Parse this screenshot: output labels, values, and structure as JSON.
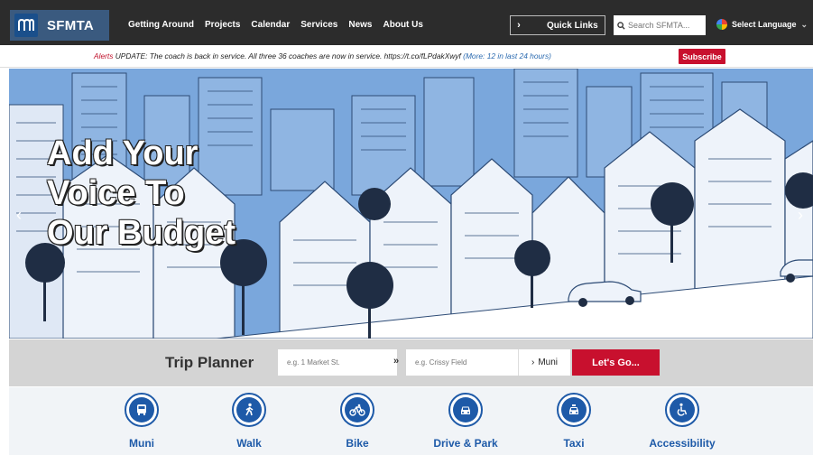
{
  "brand": {
    "name": "SFMTA",
    "logo_icon": "muni-worm-logo-icon"
  },
  "nav": {
    "items": [
      "Getting Around",
      "Projects",
      "Calendar",
      "Services",
      "News",
      "About Us"
    ]
  },
  "quick_links": {
    "label": "Quick Links",
    "icon": "chevron-right-icon"
  },
  "search": {
    "placeholder": "Search SFMTA...",
    "icon": "search-icon"
  },
  "language": {
    "label": "Select Language",
    "icon": "google-translate-icon"
  },
  "alerts": {
    "label": "Alerts",
    "message": " UPDATE: The coach is back in service. All three 36 coaches are now in service. https://t.co/fLPdakXwyf ",
    "more": "(More: 12 in last 24 hours)",
    "subscribe_label": "Subscribe"
  },
  "hero": {
    "line1": "Add Your",
    "line2": "Voice To",
    "line3": "Our Budget",
    "prev_icon": "chevron-left-icon",
    "next_icon": "chevron-right-icon",
    "slide_count": 4,
    "active_slide": 2
  },
  "trip_planner": {
    "title": "Trip Planner",
    "from_placeholder": "e.g. 1 Market St.",
    "swap_label": "»",
    "to_placeholder": "e.g. Crissy Field",
    "mode_label": "Muni",
    "go_label": "Let's Go..."
  },
  "modes": [
    {
      "label": "Muni",
      "icon": "bus-icon"
    },
    {
      "label": "Walk",
      "icon": "walking-person-icon"
    },
    {
      "label": "Bike",
      "icon": "bicycle-icon"
    },
    {
      "label": "Drive & Park",
      "icon": "car-icon"
    },
    {
      "label": "Taxi",
      "icon": "taxi-icon"
    },
    {
      "label": "Accessibility",
      "icon": "wheelchair-icon"
    }
  ],
  "colors": {
    "accent": "#c8102e",
    "brand_blue": "#1e5aa8",
    "nav_bg": "#2c2c2c",
    "hero_sky": "#7aa7dc"
  }
}
